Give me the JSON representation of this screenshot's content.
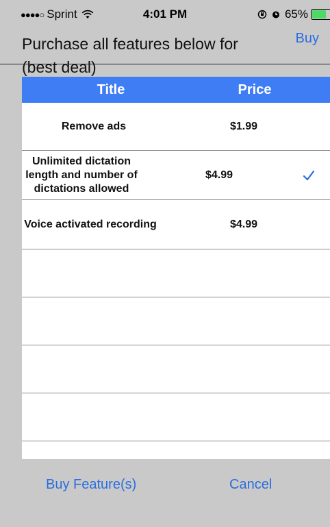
{
  "status_bar": {
    "signal": "●●●●○",
    "carrier": "Sprint",
    "time": "4:01 PM",
    "battery": "65%",
    "battery_level": 0.65,
    "wifi_icon": "wifi-icon",
    "lock_rotation_icon": "orientation-lock-icon",
    "alarm_icon": "alarm-icon"
  },
  "header": {
    "title_line1": "Purchase all features below for",
    "title_line2": "(best deal)",
    "buy_label": "Buy"
  },
  "table": {
    "columns": [
      "Title",
      "Price"
    ],
    "rows": [
      {
        "title": "Remove ads",
        "price": "$1.99",
        "selected": false
      },
      {
        "title": "Unlimited dictation length and number of dictations allowed",
        "price": "$4.99",
        "selected": true
      },
      {
        "title": "Voice activated recording",
        "price": "$4.99",
        "selected": false
      }
    ],
    "empty_rows": 4
  },
  "footer": {
    "buy_features_label": "Buy Feature(s)",
    "cancel_label": "Cancel"
  },
  "colors": {
    "accent": "#2a6dde",
    "header_bar": "#3f7df4",
    "background": "#c9c9c9",
    "battery": "#4cd964"
  }
}
